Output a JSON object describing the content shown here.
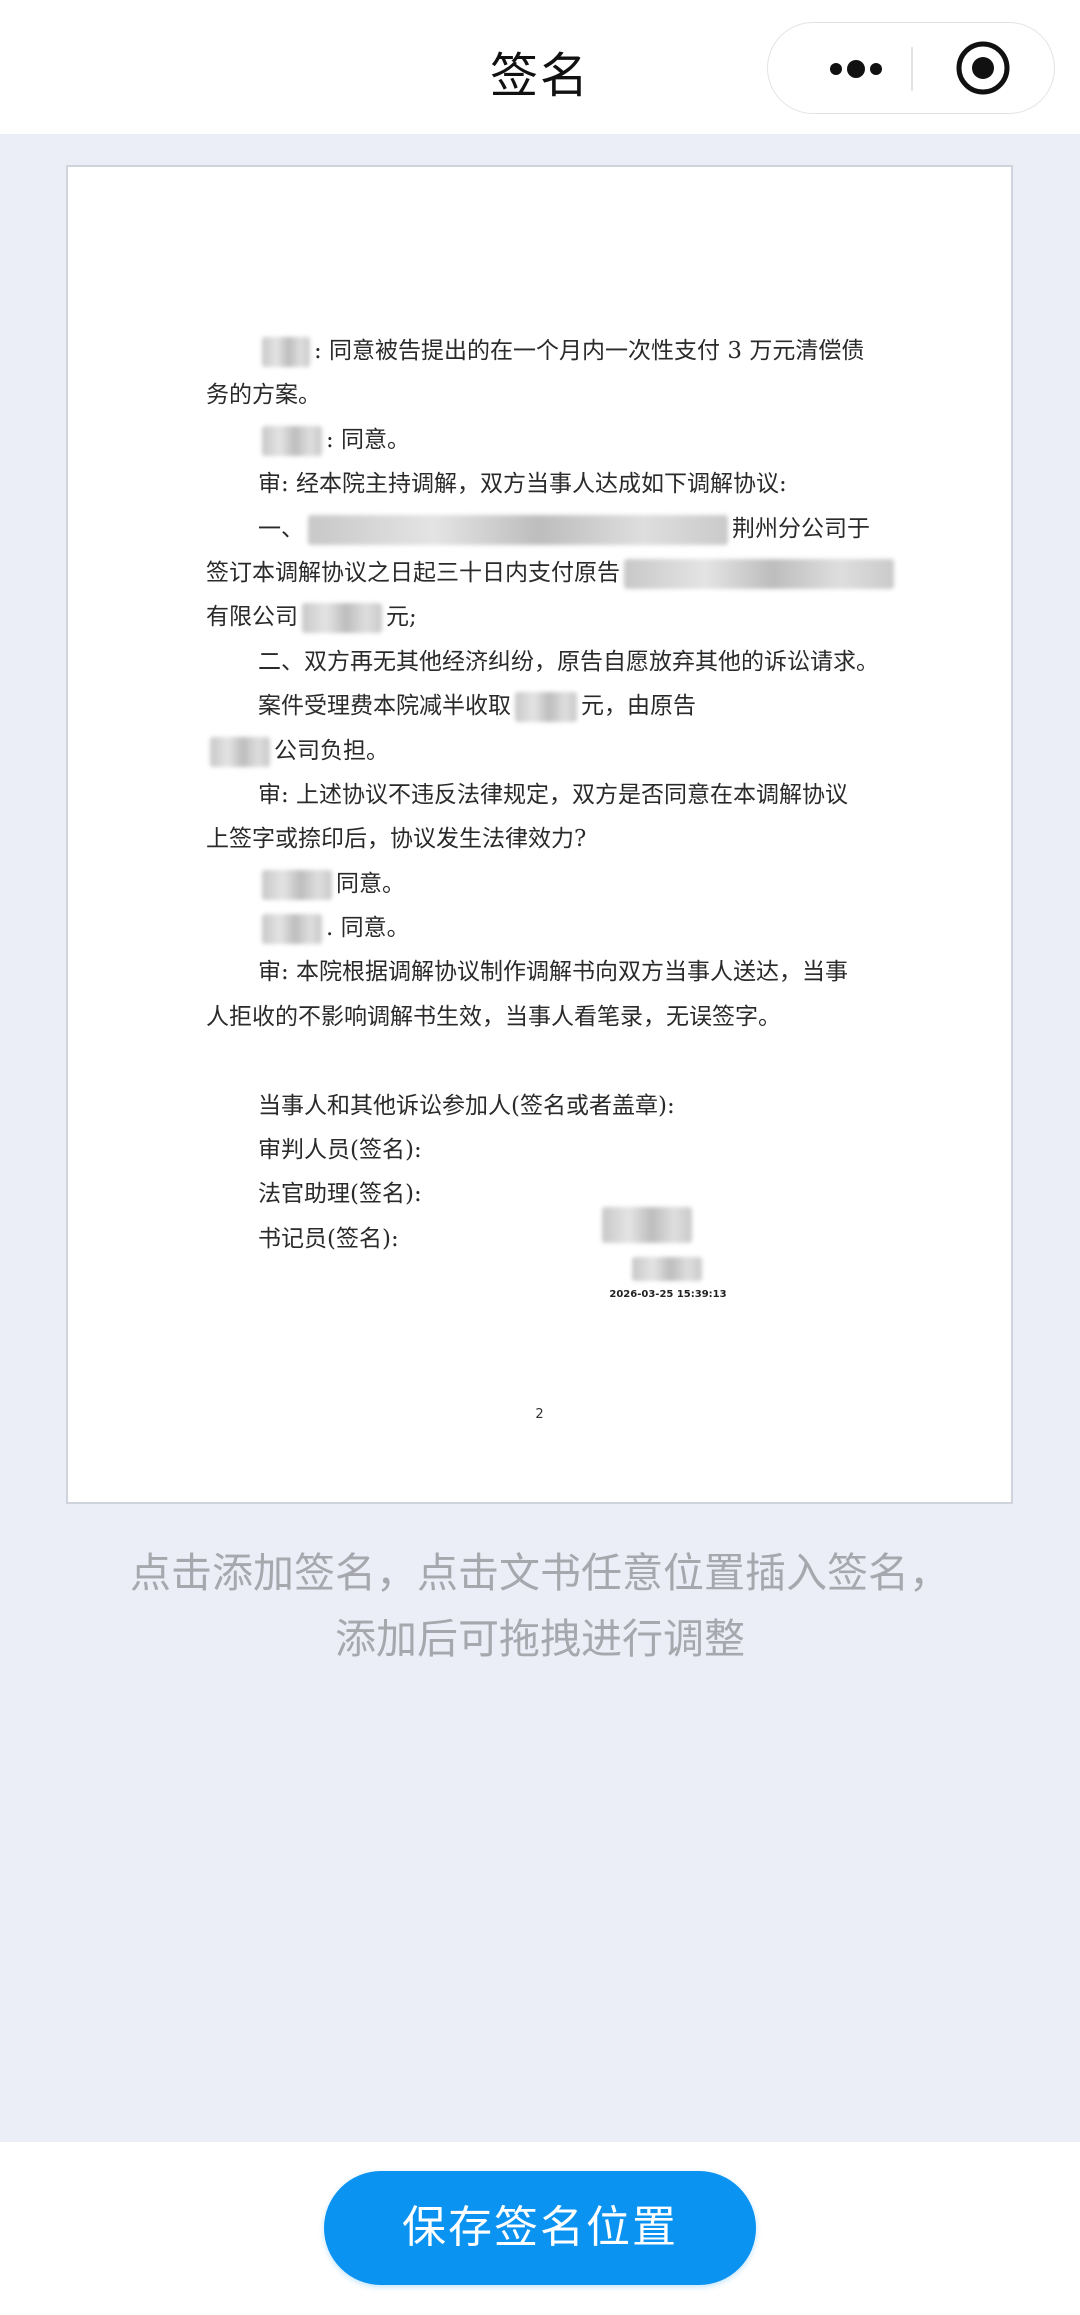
{
  "navbar": {
    "title": "签名",
    "more_icon": "more-dots-icon",
    "close_icon": "capsule-close-icon"
  },
  "document": {
    "lines": [
      {
        "pre": "",
        "redact": true,
        "text": ": 同意被告提出的在一个月内一次性支付 3 万元清偿债"
      },
      {
        "pre": "",
        "redact": false,
        "text": "务的方案。"
      },
      {
        "pre": "",
        "redact": true,
        "text": ": 同意。"
      },
      {
        "pre": "",
        "redact": false,
        "text": "审: 经本院主持调解，双方当事人达成如下调解协议:"
      },
      {
        "pre": "一、",
        "redact": true,
        "text": "荆州分公司于"
      },
      {
        "pre": "签订本调解协议之日起三十日内支付原告",
        "redact": true,
        "text": ""
      },
      {
        "pre": "有限公司",
        "redact": true,
        "text": "元;"
      },
      {
        "pre": "",
        "redact": false,
        "text": "二、双方再无其他经济纠纷，原告自愿放弃其他的诉讼请求。"
      },
      {
        "pre": "案件受理费本院减半收取",
        "redact": true,
        "text": "元，由原告"
      },
      {
        "pre": "",
        "redact": true,
        "text": "公司负担。"
      },
      {
        "pre": "",
        "redact": false,
        "text": "审: 上述协议不违反法律规定，双方是否同意在本调解协议"
      },
      {
        "pre": "",
        "redact": false,
        "text": "上签字或捺印后，协议发生法律效力?"
      },
      {
        "pre": "",
        "redact": true,
        "text": "同意。"
      },
      {
        "pre": "",
        "redact": true,
        "text": ". 同意。"
      },
      {
        "pre": "",
        "redact": false,
        "text": "审: 本院根据调解协议制作调解书向双方当事人送达，当事"
      },
      {
        "pre": "",
        "redact": false,
        "text": "人拒收的不影响调解书生效，当事人看笔录，无误签字。"
      }
    ],
    "signature_lines": [
      "当事人和其他诉讼参加人(签名或者盖章):",
      "审判人员(签名):",
      "法官助理(签名):",
      "书记员(签名):"
    ],
    "stamp_time": "2026-03-25 15:39:13",
    "page_number": "2"
  },
  "hint": {
    "line1": "点击添加签名，点击文书任意位置插入签名，",
    "line2": "添加后可拖拽进行调整"
  },
  "footer": {
    "save_label": "保存签名位置"
  }
}
